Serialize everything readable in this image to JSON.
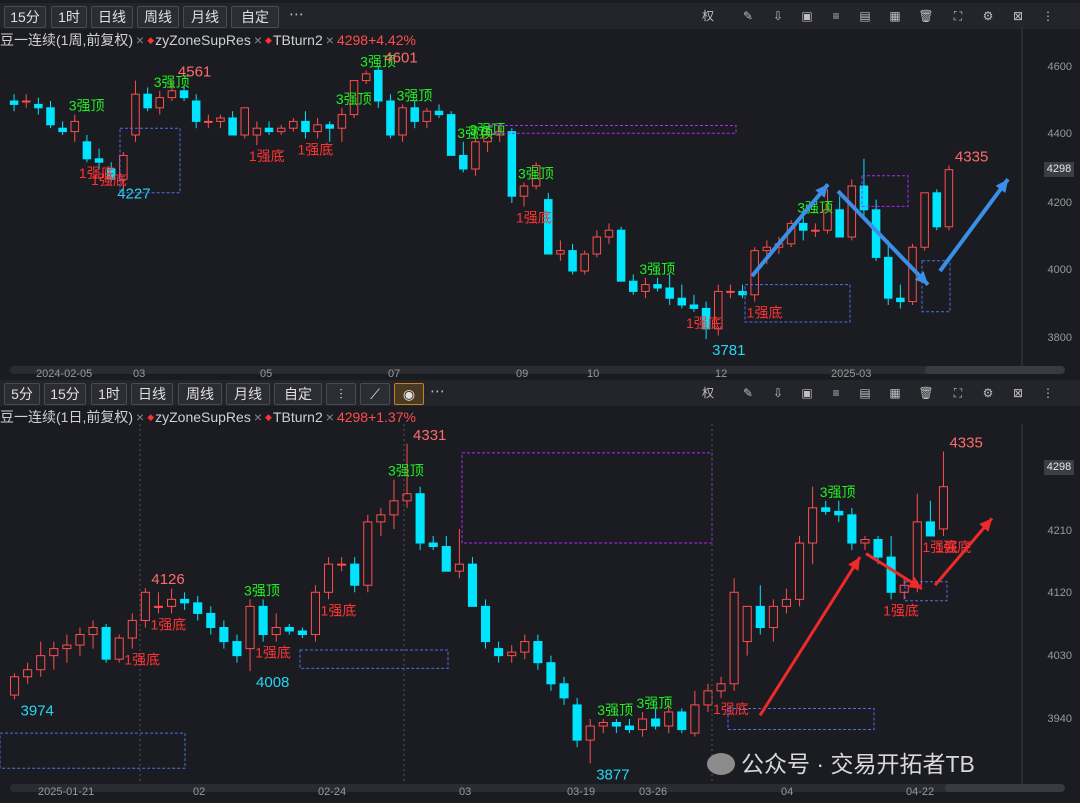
{
  "top": {
    "periods": [
      "15分",
      "1时",
      "日线",
      "周线",
      "月线",
      "自定"
    ],
    "more": "⋯",
    "tools_left": [
      "权"
    ],
    "title": {
      "main": "豆一连续(1周,前复权)",
      "ind1": "zyZoneSupRes",
      "ind2": "TBturn2",
      "price": "4298+4.42%"
    },
    "y_ticks": [
      "4600",
      "4400",
      "4298",
      "4200",
      "4000",
      "3800"
    ],
    "x_ticks": [
      "2024-02-05",
      "03",
      "05",
      "07",
      "09",
      "10",
      "12",
      "2025-03"
    ]
  },
  "bottom": {
    "periods": [
      "5分",
      "15分",
      "1时",
      "日线",
      "周线",
      "月线",
      "自定"
    ],
    "more": "⋯",
    "tools_left": [
      "权"
    ],
    "title": {
      "main": "豆一连续(1日,前复权)",
      "ind1": "zyZoneSupRes",
      "ind2": "TBturn2",
      "price": "4298+1.37%"
    },
    "y_ticks": [
      "4298",
      "4210",
      "4120",
      "4030",
      "3940"
    ],
    "x_ticks": [
      "2025-01-21",
      "02",
      "02-24",
      "03",
      "03-19",
      "03-26",
      "04",
      "04-22"
    ]
  },
  "watermark": "公众号 · 交易开拓者TB",
  "colors": {
    "up": "#ff4d4d",
    "down": "#00e5ff",
    "top_label": "#22ee22",
    "bottom_label": "#ff3333",
    "zone_top": "#b026ff",
    "zone_bottom": "#4f6ee8",
    "arrow_blue": "#3a8fe8",
    "arrow_red": "#ee2a2a"
  },
  "chart_data": [
    {
      "type": "candlestick",
      "title": "豆一连续(1周,前复权)",
      "ylim": [
        3740,
        4660
      ],
      "x": [
        "2024-02-05",
        "03",
        "05",
        "07",
        "09",
        "10",
        "12",
        "2025-03"
      ],
      "annotations_high": [
        "4561",
        "4601",
        "4335"
      ],
      "annotations_low": [
        "4227",
        "3781"
      ],
      "labels_top": [
        "3强顶",
        "3强顶",
        "3强顶",
        "3强顶",
        "3强顶",
        "3强顶",
        "3强顶",
        "3强顶",
        "3强顶",
        "3强顶"
      ],
      "labels_bottom": [
        "1强底",
        "1强底",
        "1强底",
        "1强底",
        "1强底",
        "1强底",
        "1强底"
      ],
      "ohlc": [
        [
          4500,
          4520,
          4470,
          4490
        ],
        [
          4500,
          4520,
          4480,
          4500
        ],
        [
          4490,
          4510,
          4460,
          4480
        ],
        [
          4480,
          4500,
          4420,
          4430
        ],
        [
          4420,
          4440,
          4400,
          4410
        ],
        [
          4410,
          4460,
          4380,
          4440
        ],
        [
          4380,
          4400,
          4320,
          4330
        ],
        [
          4330,
          4360,
          4300,
          4320
        ],
        [
          4300,
          4320,
          4260,
          4270
        ],
        [
          4270,
          4350,
          4240,
          4340
        ],
        [
          4400,
          4560,
          4380,
          4520
        ],
        [
          4520,
          4540,
          4470,
          4480
        ],
        [
          4480,
          4530,
          4460,
          4510
        ],
        [
          4510,
          4560,
          4500,
          4530
        ],
        [
          4530,
          4545,
          4500,
          4510
        ],
        [
          4500,
          4520,
          4420,
          4440
        ],
        [
          4440,
          4460,
          4420,
          4440
        ],
        [
          4440,
          4460,
          4420,
          4450
        ],
        [
          4450,
          4470,
          4400,
          4400
        ],
        [
          4400,
          4480,
          4390,
          4480
        ],
        [
          4400,
          4440,
          4370,
          4420
        ],
        [
          4420,
          4440,
          4400,
          4410
        ],
        [
          4410,
          4430,
          4400,
          4420
        ],
        [
          4420,
          4450,
          4410,
          4440
        ],
        [
          4440,
          4470,
          4390,
          4410
        ],
        [
          4410,
          4450,
          4390,
          4430
        ],
        [
          4430,
          4440,
          4380,
          4420
        ],
        [
          4420,
          4480,
          4380,
          4460
        ],
        [
          4460,
          4560,
          4450,
          4560
        ],
        [
          4560,
          4590,
          4550,
          4580
        ],
        [
          4590,
          4601,
          4480,
          4500
        ],
        [
          4500,
          4520,
          4390,
          4400
        ],
        [
          4400,
          4490,
          4380,
          4480
        ],
        [
          4480,
          4500,
          4420,
          4440
        ],
        [
          4440,
          4480,
          4420,
          4470
        ],
        [
          4470,
          4490,
          4450,
          4460
        ],
        [
          4460,
          4470,
          4350,
          4340
        ],
        [
          4340,
          4380,
          4290,
          4300
        ],
        [
          4300,
          4390,
          4280,
          4380
        ],
        [
          4380,
          4420,
          4350,
          4400
        ],
        [
          4400,
          4430,
          4380,
          4410
        ],
        [
          4410,
          4420,
          4200,
          4220
        ],
        [
          4220,
          4260,
          4190,
          4250
        ],
        [
          4250,
          4320,
          4240,
          4310
        ],
        [
          4210,
          4230,
          4060,
          4050
        ],
        [
          4050,
          4090,
          4030,
          4060
        ],
        [
          4060,
          4080,
          3990,
          4000
        ],
        [
          4000,
          4060,
          3990,
          4050
        ],
        [
          4050,
          4120,
          4040,
          4100
        ],
        [
          4100,
          4140,
          4080,
          4120
        ],
        [
          4120,
          4130,
          3970,
          3970
        ],
        [
          3970,
          3990,
          3930,
          3940
        ],
        [
          3940,
          3980,
          3920,
          3960
        ],
        [
          3960,
          3980,
          3940,
          3950
        ],
        [
          3950,
          3990,
          3900,
          3920
        ],
        [
          3920,
          3960,
          3890,
          3900
        ],
        [
          3900,
          3930,
          3880,
          3890
        ],
        [
          3890,
          3910,
          3800,
          3830
        ],
        [
          3830,
          3960,
          3810,
          3940
        ],
        [
          3940,
          3960,
          3920,
          3940
        ],
        [
          3940,
          3960,
          3920,
          3930
        ],
        [
          3930,
          4070,
          3910,
          4060
        ],
        [
          4060,
          4090,
          4020,
          4070
        ],
        [
          4070,
          4100,
          4050,
          4080
        ],
        [
          4080,
          4150,
          4070,
          4140
        ],
        [
          4140,
          4160,
          4090,
          4120
        ],
        [
          4120,
          4140,
          4100,
          4120
        ],
        [
          4120,
          4240,
          4110,
          4180
        ],
        [
          4180,
          4220,
          4100,
          4100
        ],
        [
          4100,
          4270,
          4090,
          4250
        ],
        [
          4250,
          4330,
          4160,
          4180
        ],
        [
          4180,
          4210,
          4030,
          4040
        ],
        [
          4040,
          4090,
          3900,
          3920
        ],
        [
          3920,
          3960,
          3890,
          3910
        ],
        [
          3910,
          4080,
          3900,
          4070
        ],
        [
          4070,
          4230,
          4060,
          4230
        ],
        [
          4230,
          4240,
          4120,
          4130
        ],
        [
          4130,
          4310,
          4120,
          4298
        ]
      ]
    },
    {
      "type": "candlestick",
      "title": "豆一连续(1日,前复权)",
      "ylim": [
        3880,
        4370
      ],
      "x": [
        "2025-01-21",
        "02",
        "02-24",
        "03",
        "03-19",
        "03-26",
        "04",
        "04-22"
      ],
      "annotations_high": [
        "4126",
        "4331",
        "4335"
      ],
      "annotations_low": [
        "3974",
        "4008",
        "3877"
      ],
      "labels_top": [
        "3强顶",
        "3强顶",
        "3强顶",
        "3强顶",
        "3强顶"
      ],
      "labels_bottom": [
        "1强底",
        "1强底",
        "1强底",
        "1强底",
        "1强底",
        "1强底",
        "1强底",
        "1强底"
      ],
      "ohlc": [
        [
          3974,
          4005,
          3968,
          4000
        ],
        [
          4000,
          4020,
          3990,
          4010
        ],
        [
          4010,
          4050,
          4000,
          4030
        ],
        [
          4030,
          4050,
          4010,
          4040
        ],
        [
          4040,
          4060,
          4020,
          4045
        ],
        [
          4045,
          4070,
          4030,
          4060
        ],
        [
          4060,
          4080,
          4040,
          4070
        ],
        [
          4070,
          4075,
          4020,
          4025
        ],
        [
          4025,
          4060,
          4020,
          4055
        ],
        [
          4055,
          4090,
          4040,
          4080
        ],
        [
          4080,
          4126,
          4070,
          4120
        ],
        [
          4100,
          4120,
          4090,
          4100
        ],
        [
          4100,
          4125,
          4090,
          4110
        ],
        [
          4110,
          4120,
          4095,
          4105
        ],
        [
          4105,
          4115,
          4080,
          4090
        ],
        [
          4090,
          4100,
          4060,
          4070
        ],
        [
          4070,
          4080,
          4040,
          4050
        ],
        [
          4050,
          4060,
          4020,
          4030
        ],
        [
          4040,
          4110,
          4008,
          4100
        ],
        [
          4100,
          4110,
          4050,
          4060
        ],
        [
          4060,
          4090,
          4050,
          4070
        ],
        [
          4070,
          4075,
          4060,
          4065
        ],
        [
          4065,
          4070,
          4055,
          4060
        ],
        [
          4060,
          4130,
          4050,
          4120
        ],
        [
          4120,
          4170,
          4110,
          4160
        ],
        [
          4160,
          4170,
          4150,
          4160
        ],
        [
          4160,
          4170,
          4120,
          4130
        ],
        [
          4130,
          4230,
          4120,
          4220
        ],
        [
          4220,
          4240,
          4200,
          4230
        ],
        [
          4230,
          4280,
          4210,
          4250
        ],
        [
          4250,
          4331,
          4240,
          4260
        ],
        [
          4260,
          4270,
          4180,
          4190
        ],
        [
          4190,
          4200,
          4180,
          4185
        ],
        [
          4185,
          4200,
          4150,
          4150
        ],
        [
          4150,
          4210,
          4140,
          4160
        ],
        [
          4160,
          4170,
          4100,
          4100
        ],
        [
          4100,
          4110,
          4040,
          4050
        ],
        [
          4040,
          4050,
          4020,
          4030
        ],
        [
          4030,
          4045,
          4020,
          4035
        ],
        [
          4035,
          4060,
          4025,
          4050
        ],
        [
          4050,
          4060,
          4010,
          4020
        ],
        [
          4020,
          4030,
          3980,
          3990
        ],
        [
          3990,
          4000,
          3960,
          3970
        ],
        [
          3960,
          3970,
          3900,
          3910
        ],
        [
          3910,
          3940,
          3877,
          3930
        ],
        [
          3930,
          3940,
          3920,
          3935
        ],
        [
          3935,
          3940,
          3920,
          3930
        ],
        [
          3930,
          3940,
          3920,
          3925
        ],
        [
          3925,
          3950,
          3915,
          3940
        ],
        [
          3940,
          3955,
          3925,
          3930
        ],
        [
          3930,
          3960,
          3920,
          3950
        ],
        [
          3950,
          3955,
          3920,
          3925
        ],
        [
          3920,
          3980,
          3915,
          3960
        ],
        [
          3960,
          3990,
          3950,
          3980
        ],
        [
          3980,
          4000,
          3970,
          3990
        ],
        [
          3990,
          4140,
          3980,
          4120
        ],
        [
          4050,
          4100,
          4030,
          4100
        ],
        [
          4100,
          4130,
          4060,
          4070
        ],
        [
          4070,
          4110,
          4050,
          4100
        ],
        [
          4100,
          4125,
          4090,
          4110
        ],
        [
          4110,
          4200,
          4100,
          4190
        ],
        [
          4190,
          4270,
          4160,
          4240
        ],
        [
          4240,
          4250,
          4230,
          4235
        ],
        [
          4235,
          4250,
          4220,
          4230
        ],
        [
          4230,
          4240,
          4180,
          4190
        ],
        [
          4190,
          4200,
          4180,
          4195
        ],
        [
          4195,
          4200,
          4160,
          4170
        ],
        [
          4170,
          4200,
          4110,
          4120
        ],
        [
          4120,
          4140,
          4110,
          4130
        ],
        [
          4130,
          4260,
          4120,
          4220
        ],
        [
          4220,
          4250,
          4200,
          4200
        ],
        [
          4210,
          4320,
          4200,
          4270
        ]
      ]
    }
  ]
}
